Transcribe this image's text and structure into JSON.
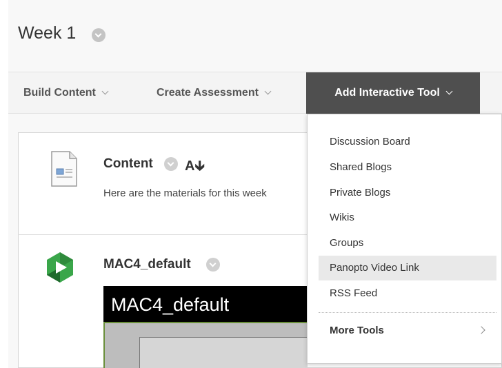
{
  "header": {
    "title": "Week 1"
  },
  "toolbar": {
    "build_content": "Build Content",
    "create_assessment": "Create Assessment",
    "add_interactive_tool": "Add Interactive Tool"
  },
  "content_items": [
    {
      "title": "Content",
      "description": "Here are the materials for this week",
      "icon": "document-icon"
    },
    {
      "title": "MAC4_default",
      "icon": "panopto-icon",
      "embed_title": "MAC4_default"
    }
  ],
  "dropdown": {
    "items": [
      {
        "label": "Discussion Board"
      },
      {
        "label": "Shared Blogs"
      },
      {
        "label": "Private Blogs"
      },
      {
        "label": "Wikis"
      },
      {
        "label": "Groups"
      },
      {
        "label": "Panopto Video Link",
        "highlighted": true
      },
      {
        "label": "RSS Feed"
      }
    ],
    "more_tools": "More Tools"
  },
  "colors": {
    "toolbar_active_bg": "#4f4f4f",
    "hover_bg": "#e9e9e9",
    "panopto_green": "#2e8b3a"
  }
}
